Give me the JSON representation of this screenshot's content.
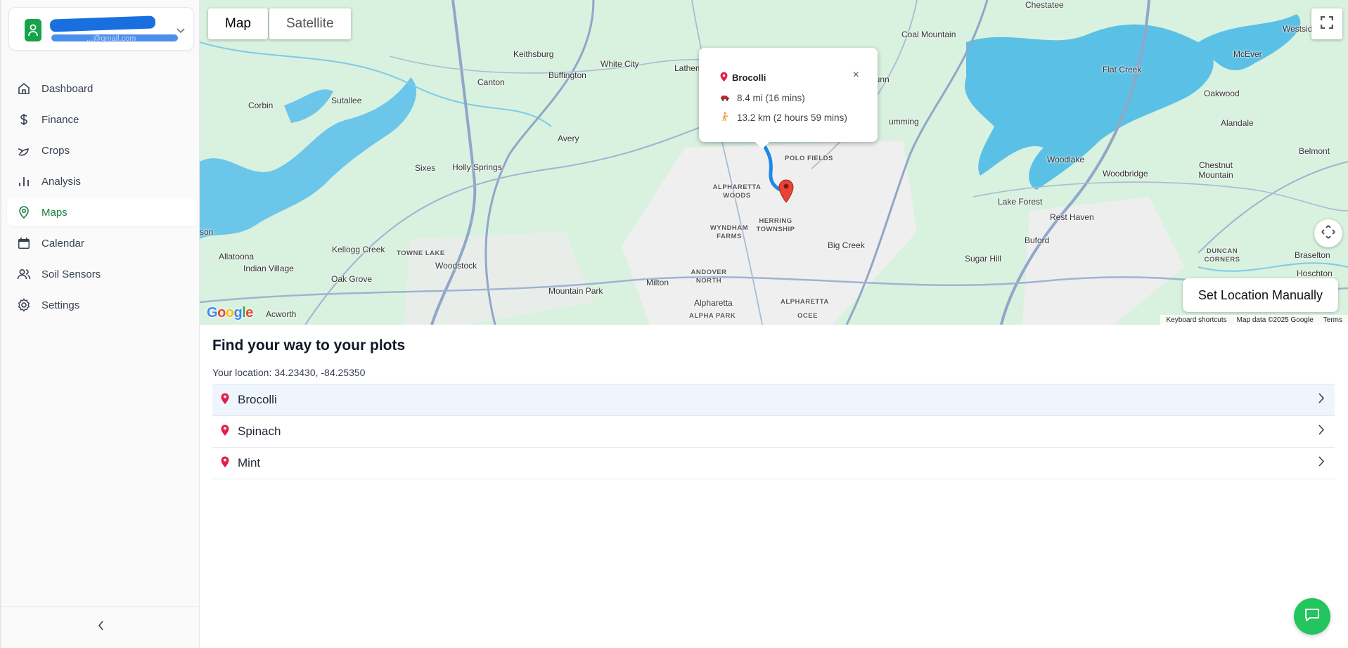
{
  "account": {
    "name": "...",
    "email": "...@gmail.com"
  },
  "sidebar": {
    "items": [
      {
        "label": "Dashboard",
        "icon": "home-icon"
      },
      {
        "label": "Finance",
        "icon": "dollar-icon"
      },
      {
        "label": "Crops",
        "icon": "sprout-icon"
      },
      {
        "label": "Analysis",
        "icon": "bar-chart-icon"
      },
      {
        "label": "Maps",
        "icon": "map-pin-icon",
        "active": true
      },
      {
        "label": "Calendar",
        "icon": "calendar-icon"
      },
      {
        "label": "Soil Sensors",
        "icon": "users-icon"
      },
      {
        "label": "Settings",
        "icon": "gear-icon"
      }
    ],
    "collapse_label": "‹"
  },
  "map": {
    "map_type_map": "Map",
    "map_type_satellite": "Satellite",
    "set_location_label": "Set Location Manually",
    "google_logo": "Google",
    "attribution": {
      "shortcuts": "Keyboard shortcuts",
      "data": "Map data ©2025 Google",
      "terms": "Terms"
    },
    "labels": {
      "keithsburg": "Keithsburg",
      "buffington": "Buffington",
      "white_city": "White City",
      "lathem": "Lathem",
      "canton": "Canton",
      "corbin": "Corbin",
      "sutallee": "Sutallee",
      "avery": "Avery",
      "sixes": "Sixes",
      "holly_springs": "Holly Springs",
      "kellogg_creek": "Kellogg Creek",
      "towne_lake": "TOWNE LAKE",
      "woodstock": "Woodstock",
      "allatoona": "Allatoona",
      "indian_village": "Indian Village",
      "oak_grove": "Oak Grove",
      "acworth": "Acworth",
      "mountain_park": "Mountain Park",
      "milton": "Milton",
      "andover_north": "ANDOVER NORTH",
      "alpharetta": "Alpharetta",
      "alpha_park": "ALPHA PARK",
      "alpharetta_caps": "ALPHARETTA",
      "ocee": "OCEE",
      "alpharetta_woods": "ALPHARETTA WOODS",
      "wyndham_farms": "WYNDHAM FARMS",
      "herring_township": "HERRING TOWNSHIP",
      "polo_fields": "POLO FIELDS",
      "big_creek": "Big Creek",
      "dunn": "Dunn",
      "cumming": "umming",
      "coal_mountain": "Coal Mountain",
      "chestatee": "Chestatee",
      "westside": "Westside",
      "mcever": "McEver",
      "flat_creek": "Flat Creek",
      "oakwood": "Oakwood",
      "alandale": "Alandale",
      "belmont": "Belmont",
      "woodlake": "Woodlake",
      "woodbridge": "Woodbridge",
      "chestnut_mountain": "Chestnut Mountain",
      "lake_forest": "Lake Forest",
      "rest_haven": "Rest Haven",
      "buford": "Buford",
      "sugar_hill": "Sugar Hill",
      "duncan_corners": "DUNCAN CORNERS",
      "braselton": "Braselton",
      "hoschton": "Hoschton",
      "son": "son"
    },
    "info_window": {
      "title": "Brocolli",
      "drive": "8.4 mi (16 mins)",
      "walk": "13.2 km (2 hours 59 mins)",
      "close_label": "×"
    }
  },
  "content": {
    "heading": "Find your way to your plots",
    "location_prefix": "Your location:",
    "location_value": "34.23430, -84.25350",
    "location_text": "Your location: 34.23430, -84.25350",
    "plots": [
      "Brocolli",
      "Spinach",
      "Mint"
    ]
  },
  "colors": {
    "accent": "#15803d",
    "chat_button": "#22c55e",
    "pin": "#e11d48"
  }
}
